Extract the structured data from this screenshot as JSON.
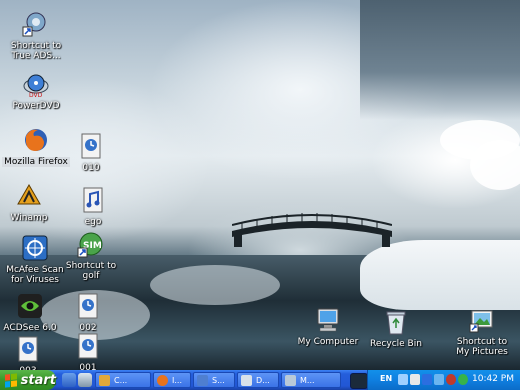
{
  "desktop_icons": [
    {
      "name": "shortcut-true-ads",
      "label": "Shortcut to\nTrue ADS...",
      "icon": "gear-shortcut-icon"
    },
    {
      "name": "powerdvd",
      "label": "PowerDVD",
      "icon": "powerdvd-icon"
    },
    {
      "name": "mozilla-firefox",
      "label": "Mozilla Firefox",
      "icon": "firefox-icon"
    },
    {
      "name": "file-010",
      "label": "010",
      "icon": "media-file-icon"
    },
    {
      "name": "winamp",
      "label": "Winamp",
      "icon": "winamp-icon"
    },
    {
      "name": "ego",
      "label": "ego",
      "icon": "audio-file-icon"
    },
    {
      "name": "mcafee-scan",
      "label": "McAfee Scan\nfor Viruses",
      "icon": "mcafee-icon"
    },
    {
      "name": "shortcut-golf",
      "label": "Shortcut to\ngolf",
      "icon": "sim-icon"
    },
    {
      "name": "acdsee",
      "label": "ACDSee 6.0",
      "icon": "acdsee-icon"
    },
    {
      "name": "file-002",
      "label": "002",
      "icon": "media-file-icon"
    },
    {
      "name": "file-003",
      "label": "003",
      "icon": "media-file-icon"
    },
    {
      "name": "file-001",
      "label": "001",
      "icon": "media-file-icon"
    },
    {
      "name": "my-computer",
      "label": "My Computer",
      "icon": "my-computer-icon"
    },
    {
      "name": "recycle-bin",
      "label": "Recycle Bin",
      "icon": "recycle-bin-icon"
    },
    {
      "name": "shortcut-my-pictures",
      "label": "Shortcut to\nMy Pictures",
      "icon": "pictures-icon"
    }
  ],
  "taskbar": {
    "start_label": "start",
    "tasks": [
      {
        "label": "C..."
      },
      {
        "label": "I..."
      },
      {
        "label": "S..."
      },
      {
        "label": "D..."
      },
      {
        "label": "M..."
      }
    ],
    "language": "EN",
    "clock": "10:42 PM"
  },
  "colors": {
    "taskbar_blue": "#245edb",
    "start_green": "#3c9a2c",
    "tray_blue": "#0f7fe0"
  }
}
